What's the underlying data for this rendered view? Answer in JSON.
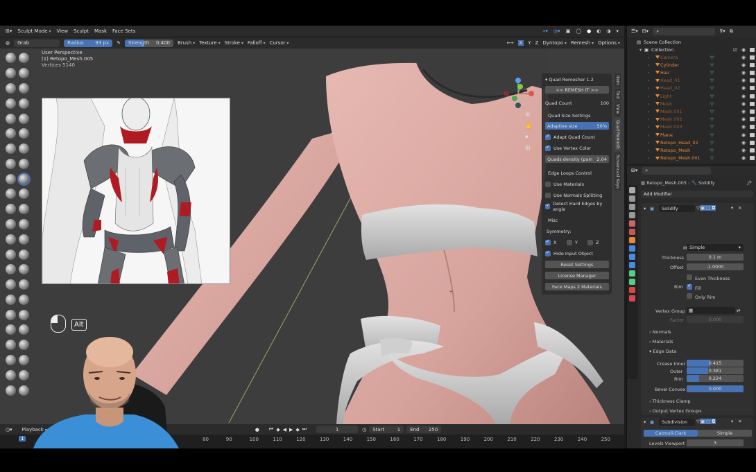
{
  "header": {
    "mode": "Sculpt Mode",
    "menus": [
      "View",
      "Sculpt",
      "Mask",
      "Face Sets"
    ],
    "right": [
      "Dyntopo",
      "Remesh",
      "Options"
    ],
    "axes": [
      "X",
      "Y",
      "Z"
    ]
  },
  "tool_settings": {
    "brush_name": "Grab",
    "radius_label": "Radius",
    "radius_value": "93 px",
    "strength_label": "Strength",
    "strength_value": "0.400",
    "menus": [
      "Brush",
      "Texture",
      "Stroke",
      "Falloff",
      "Cursor"
    ]
  },
  "viewport": {
    "perspective": "User Perspective",
    "object": "(1) Retopo_Mesh.005",
    "stats_fragment": "Vertices   5140",
    "key_hint": "Alt"
  },
  "quad_remesher": {
    "title": "Quad Remesher 1.2",
    "remesh_button": "<<  REMESH IT  >>",
    "quad_count_label": "Quad Count",
    "quad_count_value": "100",
    "size_settings": "Quad Size Settings",
    "adaptive_label": "Adaptive size",
    "adaptive_value": "50%",
    "adapt_quad_count": "Adapt Quad Count",
    "use_vertex_color": "Use Vertex Color",
    "quads_density": "Quads density (pain",
    "quads_density_value": "2.04",
    "edge_loops": "Edge Loops Control",
    "use_materials": "Use Materials",
    "use_normals": "Use Normals Splitting",
    "detect_hard": "Detect Hard Edges by angle",
    "misc": "Misc",
    "symmetry": "Symmetry:",
    "sym_x": "X",
    "sym_y": "Y",
    "sym_z": "Z",
    "hide_input": "Hide Input Object",
    "reset": "Reset Settings",
    "license": "License Manager",
    "face_maps": "Face Maps 2 Materials"
  },
  "vertical_tabs": [
    "Item",
    "Tool",
    "View",
    "Quad Remesh",
    "Screencast Keys"
  ],
  "outliner": {
    "root": "Scene Collection",
    "collection": "Collection",
    "items": [
      {
        "name": "Camera",
        "dim": true
      },
      {
        "name": "Cylinder",
        "dim": false
      },
      {
        "name": "Hair",
        "dim": false
      },
      {
        "name": "Head_01",
        "dim": true
      },
      {
        "name": "Head_02",
        "dim": true
      },
      {
        "name": "Light",
        "dim": true
      },
      {
        "name": "Mesh",
        "dim": true
      },
      {
        "name": "Mesh.001",
        "dim": true
      },
      {
        "name": "Mesh.002",
        "dim": true
      },
      {
        "name": "Mesh.003",
        "dim": true
      },
      {
        "name": "Plane",
        "dim": false
      },
      {
        "name": "Retopo_Head_02",
        "dim": false
      },
      {
        "name": "Retopo_Mesh",
        "dim": false
      },
      {
        "name": "Retopo_Mesh.001",
        "dim": false
      }
    ]
  },
  "properties": {
    "breadcrumb_object": "Retopo_Mesh.005",
    "breadcrumb_modifier": "Solidify",
    "add_modifier": "Add Modifier",
    "solidify": {
      "name": "Solidify",
      "mode_label": "Mode",
      "mode_value": "Simple",
      "thickness_label": "Thickness",
      "thickness_value": "0.1 m",
      "offset_label": "Offset",
      "offset_value": "-1.0000",
      "even_thickness": "Even Thickness",
      "rim_label": "Rim",
      "fill": "Fill",
      "only_rim": "Only Rim",
      "vertex_group_label": "Vertex Group",
      "factor_label": "Factor",
      "factor_value": "0.000",
      "normals": "Normals",
      "materials": "Materials",
      "edge_data": "Edge Data",
      "crease_inner_label": "Crease Inner",
      "crease_inner_value": "0.415",
      "crease_inner_fraction": 0.415,
      "outer_label": "Outer",
      "outer_value": "0.381",
      "outer_fraction": 0.381,
      "rim_crease_label": "Rim",
      "rim_crease_value": "0.224",
      "rim_crease_fraction": 0.224,
      "bevel_convex_label": "Bevel Convex",
      "bevel_convex_value": "0.000",
      "thickness_clamp": "Thickness Clamp",
      "output_groups": "Output Vertex Groups"
    },
    "subdivision": {
      "name": "Subdivision",
      "catmull": "Catmull-Clark",
      "simple": "Simple",
      "levels_viewport_label": "Levels Viewport",
      "levels_viewport_value": "3",
      "render_label": "Render",
      "render_value": "3",
      "optimal_display": "Optimal Display",
      "advanced": "Advanced"
    }
  },
  "timeline": {
    "playback": "Playback",
    "current_frame": "1",
    "start_label": "Start",
    "start_value": "1",
    "end_label": "End",
    "end_value": "250",
    "marker_frame": "1",
    "ticks": [
      "80",
      "90",
      "100",
      "110",
      "120",
      "130",
      "140",
      "150",
      "160",
      "170",
      "180",
      "190",
      "200",
      "210",
      "220",
      "230",
      "240",
      "250"
    ]
  },
  "colors": {
    "accent": "#4772b3",
    "skin": "#d9a9a3",
    "armor": "#c8c8c8",
    "outliner_object": "#e8883a"
  }
}
